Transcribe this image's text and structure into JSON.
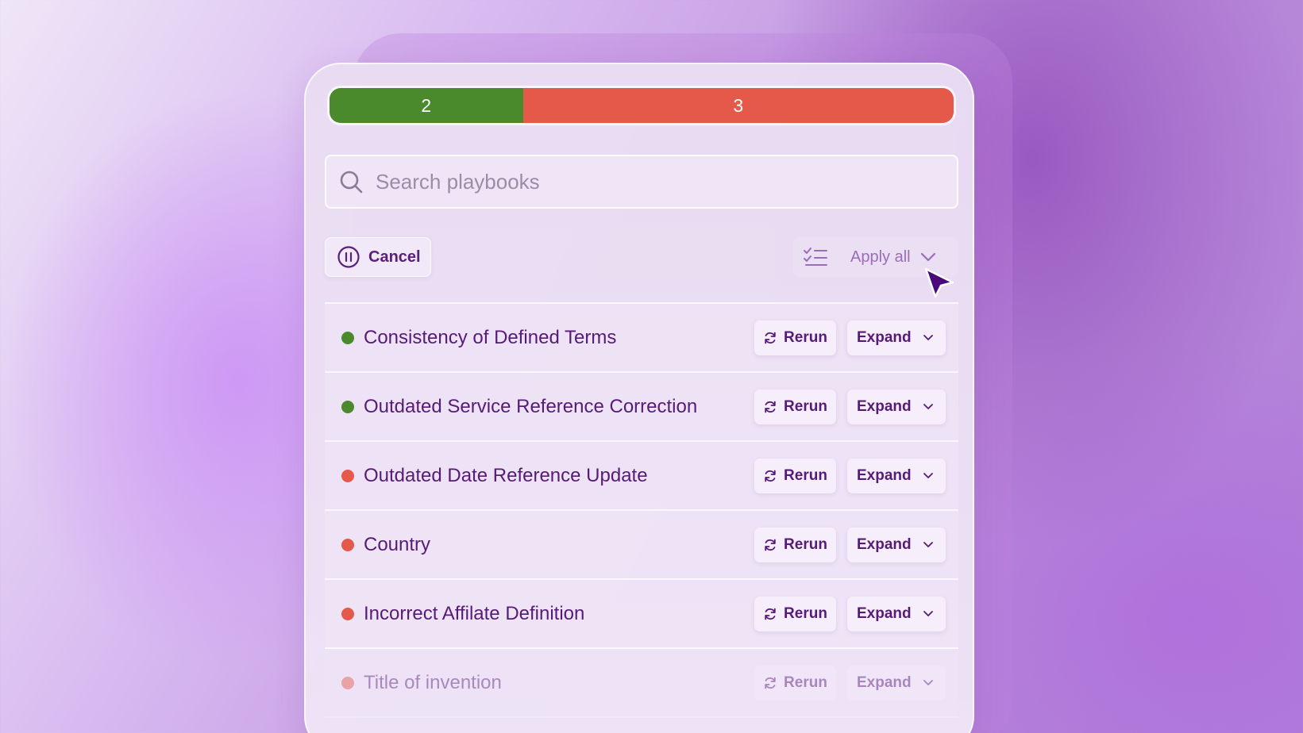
{
  "colors": {
    "success": "#4a8a2c",
    "failure": "#e5594a",
    "text_primary": "#561b77",
    "accent": "#5a1f7a"
  },
  "progress": {
    "passed_count": "2",
    "failed_count": "3",
    "passed_fraction": 0.31
  },
  "search": {
    "placeholder": "Search playbooks",
    "value": "",
    "icon": "search-icon"
  },
  "toolbar": {
    "cancel_label": "Cancel",
    "cancel_icon": "pause-circle-icon",
    "apply_label": "Apply all",
    "apply_icon": "checklist-icon",
    "apply_chevron": "chevron-down-icon"
  },
  "playbooks": [
    {
      "title": "Consistency of Defined Terms",
      "status": "passed",
      "rerun_label": "Rerun",
      "expand_label": "Expand"
    },
    {
      "title": "Outdated Service Reference Correction",
      "status": "passed",
      "rerun_label": "Rerun",
      "expand_label": "Expand"
    },
    {
      "title": "Outdated Date Reference Update",
      "status": "failed",
      "rerun_label": "Rerun",
      "expand_label": "Expand"
    },
    {
      "title": "Country",
      "status": "failed",
      "rerun_label": "Rerun",
      "expand_label": "Expand"
    },
    {
      "title": "Incorrect Affilate Definition",
      "status": "failed",
      "rerun_label": "Rerun",
      "expand_label": "Expand"
    },
    {
      "title": "Title of invention",
      "status": "failed",
      "rerun_label": "Rerun",
      "expand_label": "Expand"
    }
  ]
}
